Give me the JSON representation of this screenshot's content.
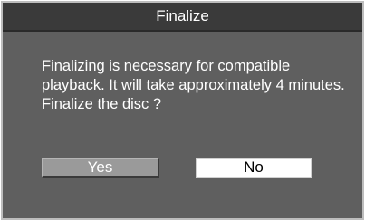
{
  "dialog": {
    "title": "Finalize",
    "message_lines": [
      "Finalizing is necessary for compatible",
      "playback. It will take approximately 4 minutes.",
      "Finalize the disc ?"
    ],
    "buttons": {
      "yes_label": "Yes",
      "no_label": "No"
    }
  },
  "colors": {
    "title_bar": "#3a3a3a",
    "body": "#5f5f5f",
    "border": "#bdbdbd",
    "yes_button": "#9a9a9a",
    "no_button": "#ffffff"
  }
}
